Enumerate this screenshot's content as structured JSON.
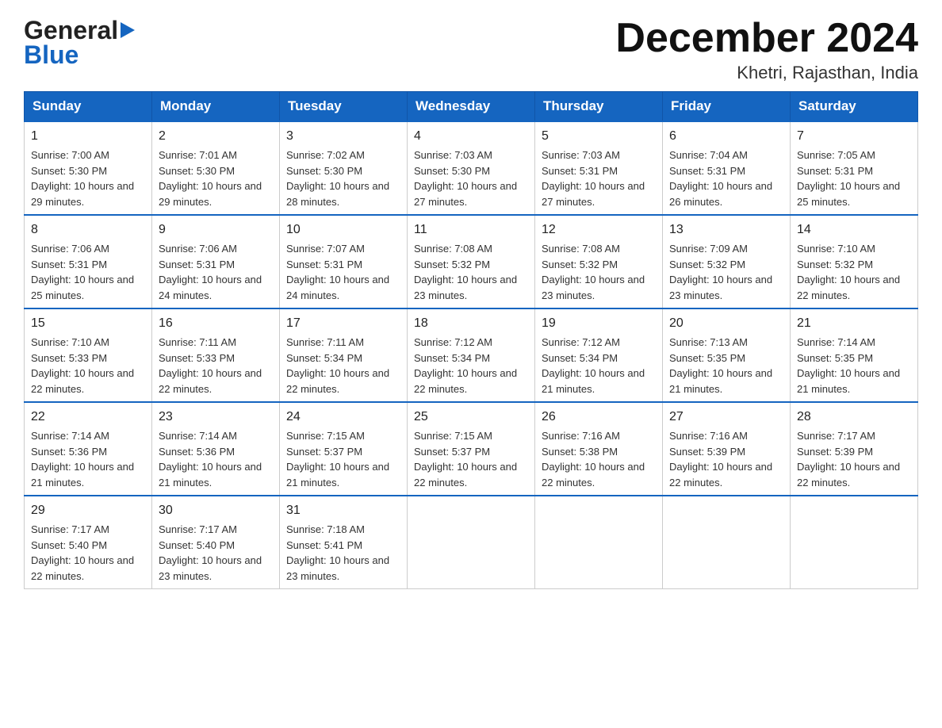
{
  "header": {
    "logo_general": "General",
    "logo_blue": "Blue",
    "month_title": "December 2024",
    "location": "Khetri, Rajasthan, India"
  },
  "days_of_week": [
    "Sunday",
    "Monday",
    "Tuesday",
    "Wednesday",
    "Thursday",
    "Friday",
    "Saturday"
  ],
  "weeks": [
    [
      {
        "day": "1",
        "sunrise": "Sunrise: 7:00 AM",
        "sunset": "Sunset: 5:30 PM",
        "daylight": "Daylight: 10 hours and 29 minutes."
      },
      {
        "day": "2",
        "sunrise": "Sunrise: 7:01 AM",
        "sunset": "Sunset: 5:30 PM",
        "daylight": "Daylight: 10 hours and 29 minutes."
      },
      {
        "day": "3",
        "sunrise": "Sunrise: 7:02 AM",
        "sunset": "Sunset: 5:30 PM",
        "daylight": "Daylight: 10 hours and 28 minutes."
      },
      {
        "day": "4",
        "sunrise": "Sunrise: 7:03 AM",
        "sunset": "Sunset: 5:30 PM",
        "daylight": "Daylight: 10 hours and 27 minutes."
      },
      {
        "day": "5",
        "sunrise": "Sunrise: 7:03 AM",
        "sunset": "Sunset: 5:31 PM",
        "daylight": "Daylight: 10 hours and 27 minutes."
      },
      {
        "day": "6",
        "sunrise": "Sunrise: 7:04 AM",
        "sunset": "Sunset: 5:31 PM",
        "daylight": "Daylight: 10 hours and 26 minutes."
      },
      {
        "day": "7",
        "sunrise": "Sunrise: 7:05 AM",
        "sunset": "Sunset: 5:31 PM",
        "daylight": "Daylight: 10 hours and 25 minutes."
      }
    ],
    [
      {
        "day": "8",
        "sunrise": "Sunrise: 7:06 AM",
        "sunset": "Sunset: 5:31 PM",
        "daylight": "Daylight: 10 hours and 25 minutes."
      },
      {
        "day": "9",
        "sunrise": "Sunrise: 7:06 AM",
        "sunset": "Sunset: 5:31 PM",
        "daylight": "Daylight: 10 hours and 24 minutes."
      },
      {
        "day": "10",
        "sunrise": "Sunrise: 7:07 AM",
        "sunset": "Sunset: 5:31 PM",
        "daylight": "Daylight: 10 hours and 24 minutes."
      },
      {
        "day": "11",
        "sunrise": "Sunrise: 7:08 AM",
        "sunset": "Sunset: 5:32 PM",
        "daylight": "Daylight: 10 hours and 23 minutes."
      },
      {
        "day": "12",
        "sunrise": "Sunrise: 7:08 AM",
        "sunset": "Sunset: 5:32 PM",
        "daylight": "Daylight: 10 hours and 23 minutes."
      },
      {
        "day": "13",
        "sunrise": "Sunrise: 7:09 AM",
        "sunset": "Sunset: 5:32 PM",
        "daylight": "Daylight: 10 hours and 23 minutes."
      },
      {
        "day": "14",
        "sunrise": "Sunrise: 7:10 AM",
        "sunset": "Sunset: 5:32 PM",
        "daylight": "Daylight: 10 hours and 22 minutes."
      }
    ],
    [
      {
        "day": "15",
        "sunrise": "Sunrise: 7:10 AM",
        "sunset": "Sunset: 5:33 PM",
        "daylight": "Daylight: 10 hours and 22 minutes."
      },
      {
        "day": "16",
        "sunrise": "Sunrise: 7:11 AM",
        "sunset": "Sunset: 5:33 PM",
        "daylight": "Daylight: 10 hours and 22 minutes."
      },
      {
        "day": "17",
        "sunrise": "Sunrise: 7:11 AM",
        "sunset": "Sunset: 5:34 PM",
        "daylight": "Daylight: 10 hours and 22 minutes."
      },
      {
        "day": "18",
        "sunrise": "Sunrise: 7:12 AM",
        "sunset": "Sunset: 5:34 PM",
        "daylight": "Daylight: 10 hours and 22 minutes."
      },
      {
        "day": "19",
        "sunrise": "Sunrise: 7:12 AM",
        "sunset": "Sunset: 5:34 PM",
        "daylight": "Daylight: 10 hours and 21 minutes."
      },
      {
        "day": "20",
        "sunrise": "Sunrise: 7:13 AM",
        "sunset": "Sunset: 5:35 PM",
        "daylight": "Daylight: 10 hours and 21 minutes."
      },
      {
        "day": "21",
        "sunrise": "Sunrise: 7:14 AM",
        "sunset": "Sunset: 5:35 PM",
        "daylight": "Daylight: 10 hours and 21 minutes."
      }
    ],
    [
      {
        "day": "22",
        "sunrise": "Sunrise: 7:14 AM",
        "sunset": "Sunset: 5:36 PM",
        "daylight": "Daylight: 10 hours and 21 minutes."
      },
      {
        "day": "23",
        "sunrise": "Sunrise: 7:14 AM",
        "sunset": "Sunset: 5:36 PM",
        "daylight": "Daylight: 10 hours and 21 minutes."
      },
      {
        "day": "24",
        "sunrise": "Sunrise: 7:15 AM",
        "sunset": "Sunset: 5:37 PM",
        "daylight": "Daylight: 10 hours and 21 minutes."
      },
      {
        "day": "25",
        "sunrise": "Sunrise: 7:15 AM",
        "sunset": "Sunset: 5:37 PM",
        "daylight": "Daylight: 10 hours and 22 minutes."
      },
      {
        "day": "26",
        "sunrise": "Sunrise: 7:16 AM",
        "sunset": "Sunset: 5:38 PM",
        "daylight": "Daylight: 10 hours and 22 minutes."
      },
      {
        "day": "27",
        "sunrise": "Sunrise: 7:16 AM",
        "sunset": "Sunset: 5:39 PM",
        "daylight": "Daylight: 10 hours and 22 minutes."
      },
      {
        "day": "28",
        "sunrise": "Sunrise: 7:17 AM",
        "sunset": "Sunset: 5:39 PM",
        "daylight": "Daylight: 10 hours and 22 minutes."
      }
    ],
    [
      {
        "day": "29",
        "sunrise": "Sunrise: 7:17 AM",
        "sunset": "Sunset: 5:40 PM",
        "daylight": "Daylight: 10 hours and 22 minutes."
      },
      {
        "day": "30",
        "sunrise": "Sunrise: 7:17 AM",
        "sunset": "Sunset: 5:40 PM",
        "daylight": "Daylight: 10 hours and 23 minutes."
      },
      {
        "day": "31",
        "sunrise": "Sunrise: 7:18 AM",
        "sunset": "Sunset: 5:41 PM",
        "daylight": "Daylight: 10 hours and 23 minutes."
      },
      {
        "day": "",
        "sunrise": "",
        "sunset": "",
        "daylight": ""
      },
      {
        "day": "",
        "sunrise": "",
        "sunset": "",
        "daylight": ""
      },
      {
        "day": "",
        "sunrise": "",
        "sunset": "",
        "daylight": ""
      },
      {
        "day": "",
        "sunrise": "",
        "sunset": "",
        "daylight": ""
      }
    ]
  ]
}
